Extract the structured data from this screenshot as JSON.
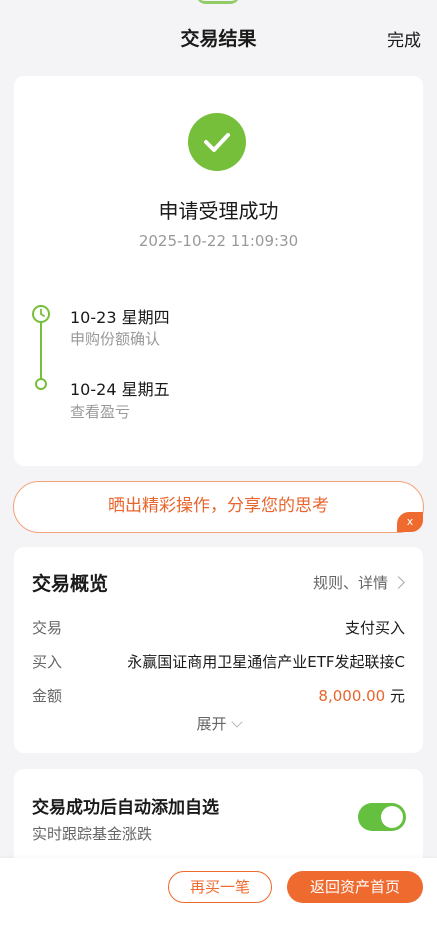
{
  "header": {
    "title": "交易结果",
    "done_label": "完成"
  },
  "result": {
    "title": "申请受理成功",
    "time": "2025-10-22 11:09:30",
    "timeline": [
      {
        "date": "10-23  星期四",
        "desc": "申购份额确认"
      },
      {
        "date": "10-24  星期五",
        "desc": "查看盈亏"
      }
    ],
    "success_color": "#76bf3a"
  },
  "share_banner": {
    "text": "晒出精彩操作，分享您的思考",
    "close_label": "x"
  },
  "overview": {
    "title": "交易概览",
    "link_label": "规则、详情",
    "rows": [
      {
        "label": "交易",
        "value": "支付买入"
      },
      {
        "label": "买入",
        "value": "永赢国证商用卫星通信产业ETF发起联接C"
      },
      {
        "label": "金额",
        "amount": "8,000.00",
        "unit": " 元"
      }
    ],
    "expand_label": "展开"
  },
  "watchlist": {
    "title": "交易成功后自动添加自选",
    "subtitle": "实时跟踪基金涨跌",
    "toggle_on": true
  },
  "footer": {
    "rebuy_label": "再买一笔",
    "home_label": "返回资产首页",
    "accent_color": "#ef6a2e"
  }
}
